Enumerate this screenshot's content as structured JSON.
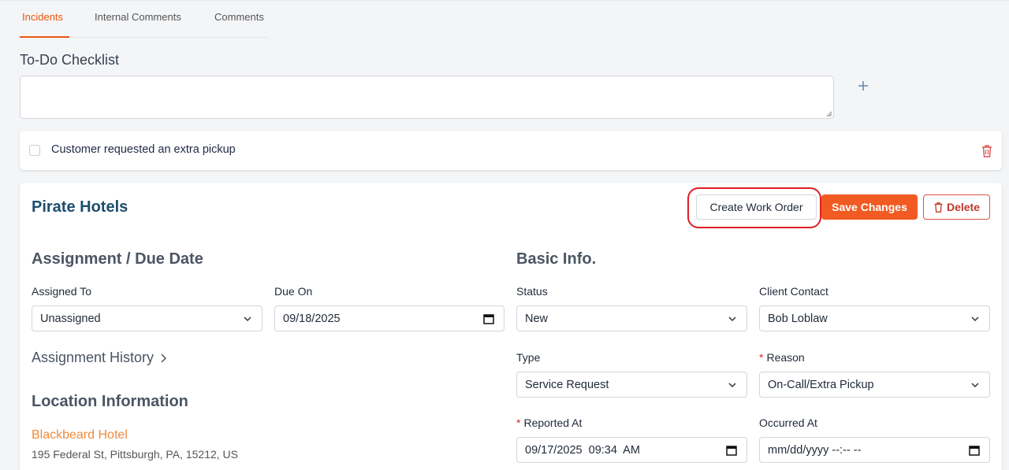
{
  "tabs": [
    {
      "label": "Incidents",
      "active": true
    },
    {
      "label": "Internal Comments",
      "active": false
    },
    {
      "label": "Comments",
      "active": false
    }
  ],
  "todo": {
    "title": "To-Do Checklist",
    "input_value": "",
    "items": [
      {
        "text": "Customer requested an extra pickup",
        "checked": false
      }
    ]
  },
  "incident": {
    "company": "Pirate Hotels",
    "buttons": {
      "create_work_order": "Create Work Order",
      "save_changes": "Save Changes",
      "delete": "Delete"
    },
    "assignment": {
      "title": "Assignment / Due Date",
      "assigned_to_label": "Assigned To",
      "assigned_to_value": "Unassigned",
      "due_on_label": "Due On",
      "due_on_value": "09/18/2025",
      "history_label": "Assignment History"
    },
    "location": {
      "title": "Location Information",
      "name": "Blackbeard Hotel",
      "address": "195 Federal St, Pittsburgh, PA, 15212, US"
    },
    "basic": {
      "title": "Basic Info.",
      "status_label": "Status",
      "status_value": "New",
      "client_contact_label": "Client Contact",
      "client_contact_value": "Bob Loblaw",
      "type_label": "Type",
      "type_value": "Service Request",
      "reason_label": "Reason",
      "reason_value": "On-Call/Extra Pickup",
      "reported_at_label": "Reported At",
      "reported_at_value": "09/17/2025  09:34  AM",
      "occurred_at_label": "Occurred At",
      "occurred_at_value": "mm/dd/yyyy --:-- --"
    }
  },
  "colors": {
    "accent": "#ea580c",
    "save": "#f15a22",
    "delete": "#c0392b",
    "highlight": "#e11d24",
    "company": "#1e4e6e",
    "location_link": "#f08a3c"
  }
}
